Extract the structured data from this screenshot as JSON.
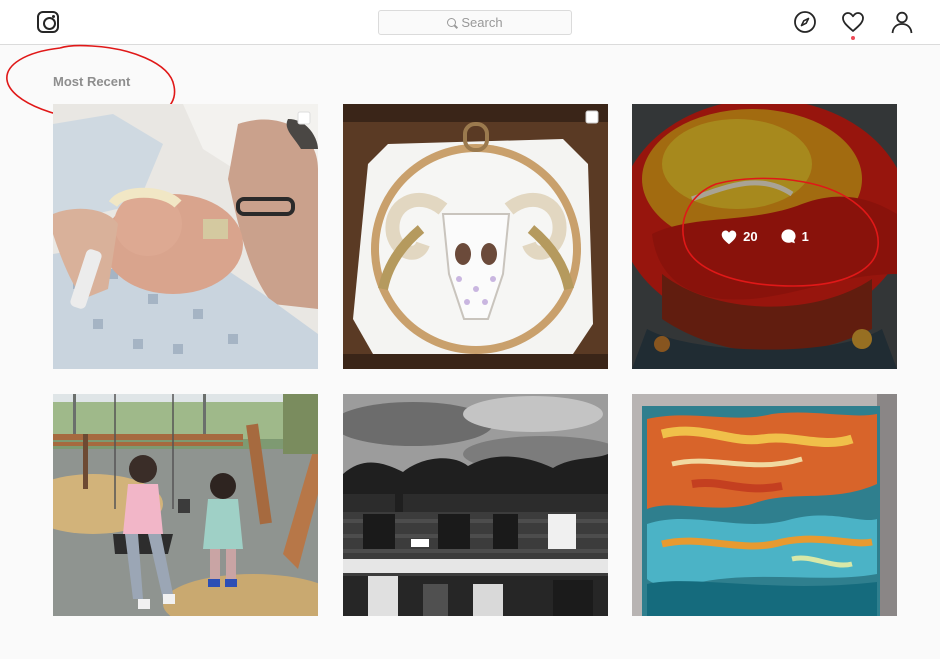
{
  "app": {
    "name": "Instagram"
  },
  "search": {
    "placeholder": "Search"
  },
  "section": {
    "title": "Most Recent"
  },
  "nav": {
    "icons": [
      "compass-icon",
      "heart-icon",
      "profile-icon"
    ]
  },
  "posts": [
    {
      "type": "multiple",
      "description": "newborn baby with grandmother",
      "hover": false
    },
    {
      "type": "multiple",
      "description": "ram skull embroidery hoop",
      "hover": false
    },
    {
      "type": "single",
      "description": "red and orange fluid resin art",
      "hover": true,
      "likes": "20",
      "comments": "1"
    },
    {
      "type": "single",
      "description": "children on playground swings",
      "hover": false
    },
    {
      "type": "single",
      "description": "black and white derelict building",
      "hover": false
    },
    {
      "type": "single",
      "description": "blue and orange fluid art canvas",
      "hover": false
    }
  ],
  "colors": {
    "accent": "#ed4956",
    "annotation": "#e01818"
  }
}
